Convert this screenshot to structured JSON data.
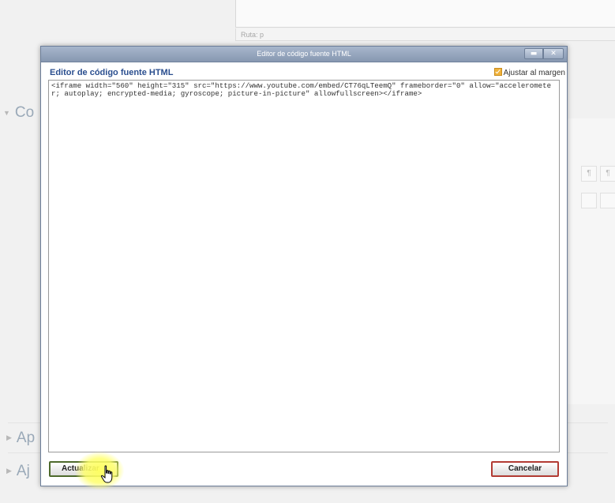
{
  "background": {
    "path_label": "Ruta: p",
    "sections": [
      {
        "label": "Co"
      },
      {
        "label": "Ap"
      },
      {
        "label": "Aj"
      }
    ],
    "toolbar_glyphs": [
      "¶",
      "¶"
    ]
  },
  "dialog": {
    "window_title": "Editor de código fuente HTML",
    "heading": "Editor de código fuente HTML",
    "wrap_label": "Ajustar al margen",
    "wrap_checked": true,
    "code": "<iframe width=\"560\" height=\"315\" src=\"https://www.youtube.com/embed/CT76qLTeemQ\" frameborder=\"0\" allow=\"accelerometer; autoplay; encrypted-media; gyroscope; picture-in-picture\" allowfullscreen></iframe>",
    "update_button": "Actualizar",
    "cancel_button": "Cancelar"
  },
  "colors": {
    "titlebar": "#8798b1",
    "heading": "#2b4f8f",
    "update_border": "#4e6a2c",
    "cancel_border": "#b23b33",
    "checkbox": "#f0b23a"
  }
}
